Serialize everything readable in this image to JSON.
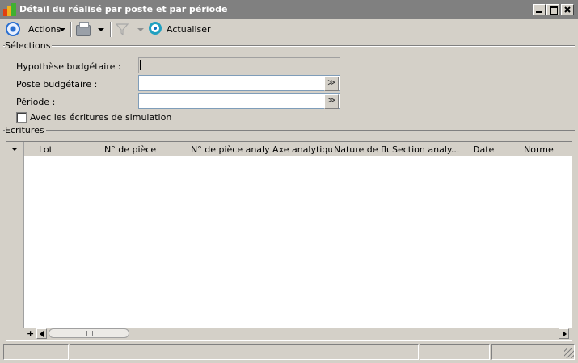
{
  "window": {
    "title": "Détail du réalisé par poste et par période",
    "controls": [
      "minimize-icon",
      "maximize-icon",
      "close-icon"
    ]
  },
  "toolbar": {
    "actions_label": "Actions",
    "refresh_label": "Actualiser",
    "icons": [
      "actions-icon",
      "printer-icon",
      "filter-icon",
      "refresh-icon"
    ]
  },
  "selections": {
    "title": "Sélections",
    "hypothese_label": "Hypothèse budgétaire :",
    "hypothese_value": "",
    "poste_label": "Poste budgétaire :",
    "poste_value": "",
    "periode_label": "Période :",
    "periode_value": "",
    "simulation_label": "Avec les écritures de simulation",
    "simulation_checked": false
  },
  "ecritures": {
    "title": "Ecritures",
    "columns": [
      "Lot",
      "N° de pièce",
      "N° de pièce analyt...",
      "Axe analytique",
      "Nature de flux",
      "Section analy...",
      "Date",
      "Norme"
    ],
    "rows": [],
    "add_label": "+"
  },
  "statusbar": {
    "panels": [
      "",
      "",
      "",
      ""
    ]
  },
  "colors": {
    "titlebar": "#808080",
    "face": "#d4d0c8",
    "accent": "#2a6fd0"
  }
}
